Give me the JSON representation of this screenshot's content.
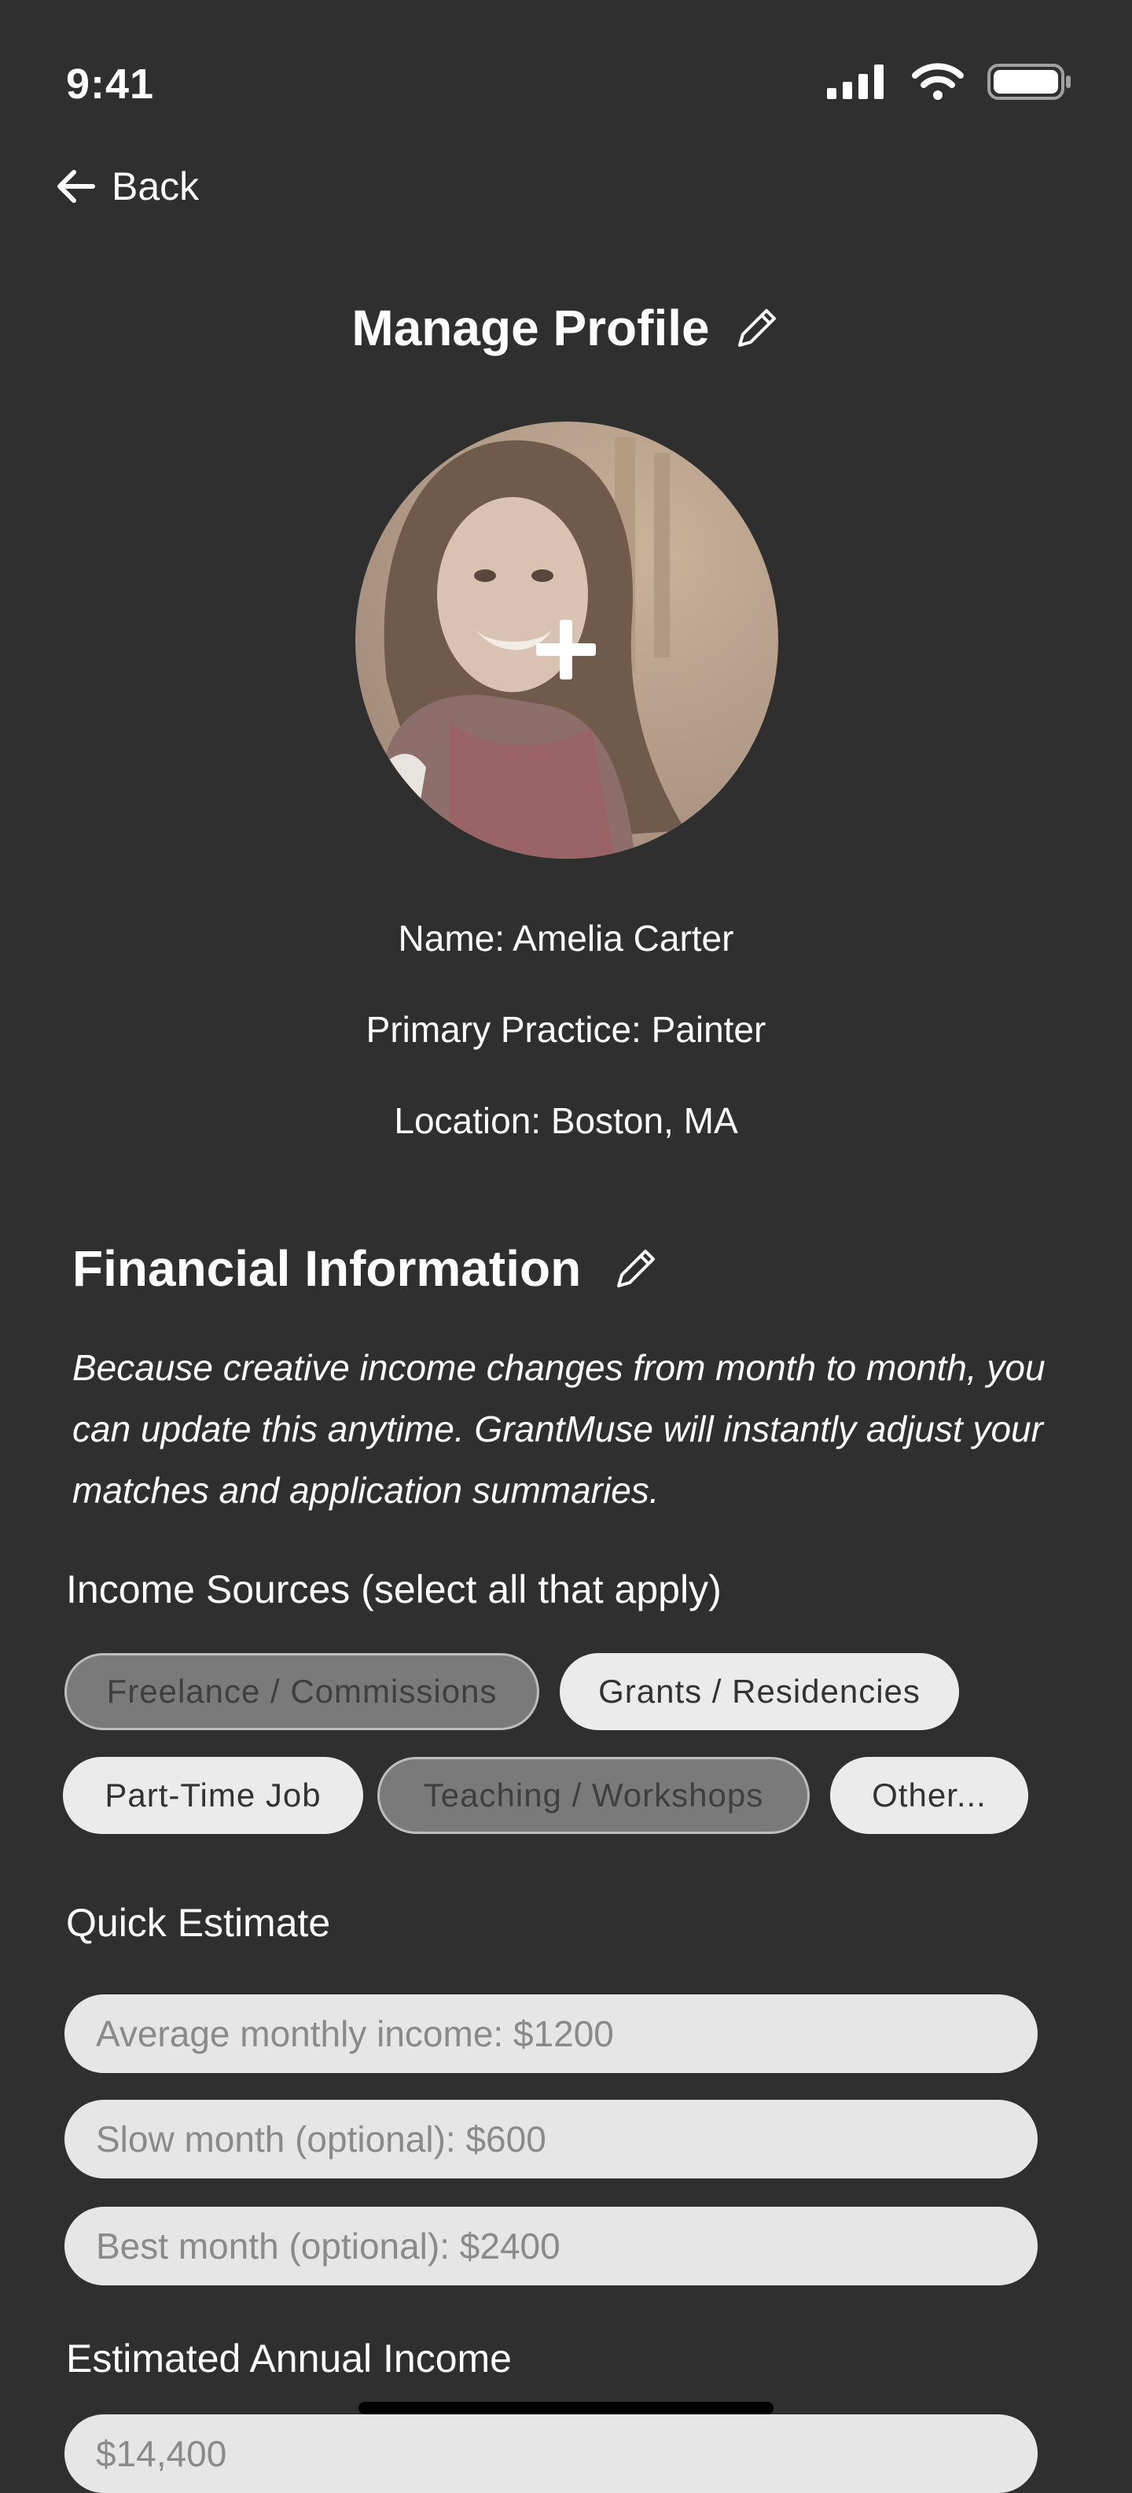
{
  "status_bar": {
    "time": "9:41"
  },
  "nav": {
    "back_label": "Back"
  },
  "header": {
    "title": "Manage Profile"
  },
  "profile": {
    "name": "Name: Amelia Carter",
    "practice": "Primary Practice: Painter",
    "location": "Location: Boston, MA"
  },
  "financial": {
    "title": "Financial Information",
    "description": "Because creative income changes from month to month, you can update this anytime. GrantMuse will instantly adjust your matches and application summaries.",
    "income_sources_label": "Income Sources (select all that apply)",
    "income_sources": [
      {
        "label": "Freelance / Commissions",
        "selected": true
      },
      {
        "label": "Grants / Residencies",
        "selected": false
      },
      {
        "label": "Part-Time Job",
        "selected": false
      },
      {
        "label": "Teaching / Workshops",
        "selected": true
      },
      {
        "label": "Other...",
        "selected": false
      }
    ],
    "quick_estimate_label": "Quick Estimate",
    "fields": {
      "average_monthly": "Average monthly income: $1200",
      "slow_month": "Slow month (optional): $600",
      "best_month": "Best month (optional): $2400"
    },
    "annual_income_label": "Estimated Annual Income",
    "annual_income_value": "$14,400"
  },
  "colors": {
    "background": "#2f2f2f",
    "chip_selected": "#7a7a7a",
    "chip_unselected": "#ebebeb",
    "field_background": "#e6e6e6"
  }
}
